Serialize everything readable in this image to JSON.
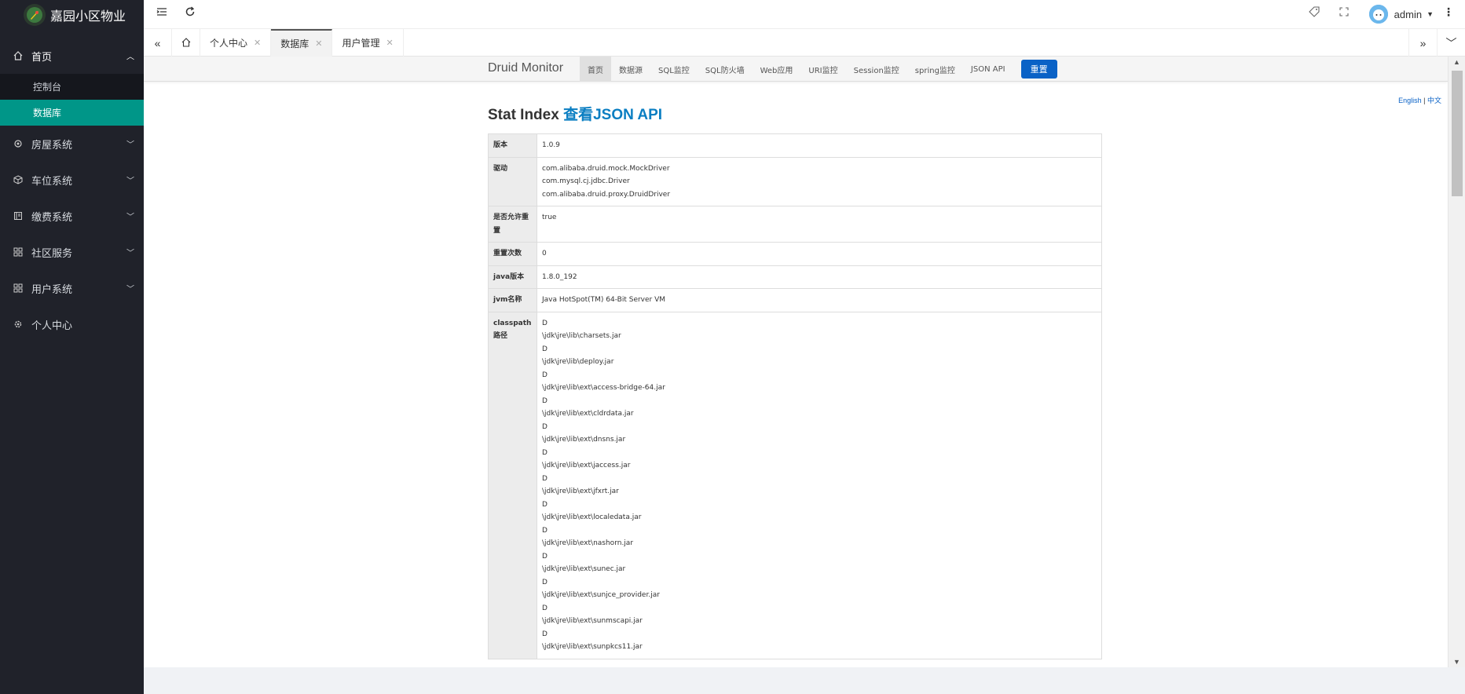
{
  "sidebar": {
    "brand": "嘉园小区物业",
    "menu": [
      {
        "label": "首页",
        "open": true,
        "children": [
          {
            "label": "控制台",
            "active": false
          },
          {
            "label": "数据库",
            "active": true
          }
        ]
      },
      {
        "label": "房屋系统"
      },
      {
        "label": "车位系统"
      },
      {
        "label": "缴费系统"
      },
      {
        "label": "社区服务"
      },
      {
        "label": "用户系统"
      },
      {
        "label": "个人中心"
      }
    ]
  },
  "header": {
    "username": "admin"
  },
  "tabs": [
    {
      "label": "个人中心",
      "closable": true,
      "active": false
    },
    {
      "label": "数据库",
      "closable": true,
      "active": true
    },
    {
      "label": "用户管理",
      "closable": true,
      "active": false
    }
  ],
  "druid": {
    "brand": "Druid Monitor",
    "nav": [
      "首页",
      "数据源",
      "SQL监控",
      "SQL防火墙",
      "Web应用",
      "URI监控",
      "Session监控",
      "spring监控",
      "JSON API"
    ],
    "reset_label": "重置",
    "lang_en": "English",
    "lang_sep": "|",
    "lang_zh": "中文",
    "title": "Stat Index",
    "title_link": "查看JSON API",
    "rows": [
      {
        "key": "版本",
        "lines": [
          "1.0.9"
        ]
      },
      {
        "key": "驱动",
        "lines": [
          "com.alibaba.druid.mock.MockDriver",
          "com.mysql.cj.jdbc.Driver",
          "com.alibaba.druid.proxy.DruidDriver"
        ]
      },
      {
        "key": "是否允许重置",
        "lines": [
          "true"
        ]
      },
      {
        "key": "重置次数",
        "lines": [
          "0"
        ]
      },
      {
        "key": "java版本",
        "lines": [
          "1.8.0_192"
        ]
      },
      {
        "key": "jvm名称",
        "lines": [
          "Java HotSpot(TM) 64-Bit Server VM"
        ]
      },
      {
        "key": "classpath路径",
        "lines": [
          "D",
          "\\jdk\\jre\\lib\\charsets.jar",
          "D",
          "\\jdk\\jre\\lib\\deploy.jar",
          "D",
          "\\jdk\\jre\\lib\\ext\\access-bridge-64.jar",
          "D",
          "\\jdk\\jre\\lib\\ext\\cldrdata.jar",
          "D",
          "\\jdk\\jre\\lib\\ext\\dnsns.jar",
          "D",
          "\\jdk\\jre\\lib\\ext\\jaccess.jar",
          "D",
          "\\jdk\\jre\\lib\\ext\\jfxrt.jar",
          "D",
          "\\jdk\\jre\\lib\\ext\\localedata.jar",
          "D",
          "\\jdk\\jre\\lib\\ext\\nashorn.jar",
          "D",
          "\\jdk\\jre\\lib\\ext\\sunec.jar",
          "D",
          "\\jdk\\jre\\lib\\ext\\sunjce_provider.jar",
          "D",
          "\\jdk\\jre\\lib\\ext\\sunmscapi.jar",
          "D",
          "\\jdk\\jre\\lib\\ext\\sunpkcs11.jar"
        ]
      }
    ]
  }
}
